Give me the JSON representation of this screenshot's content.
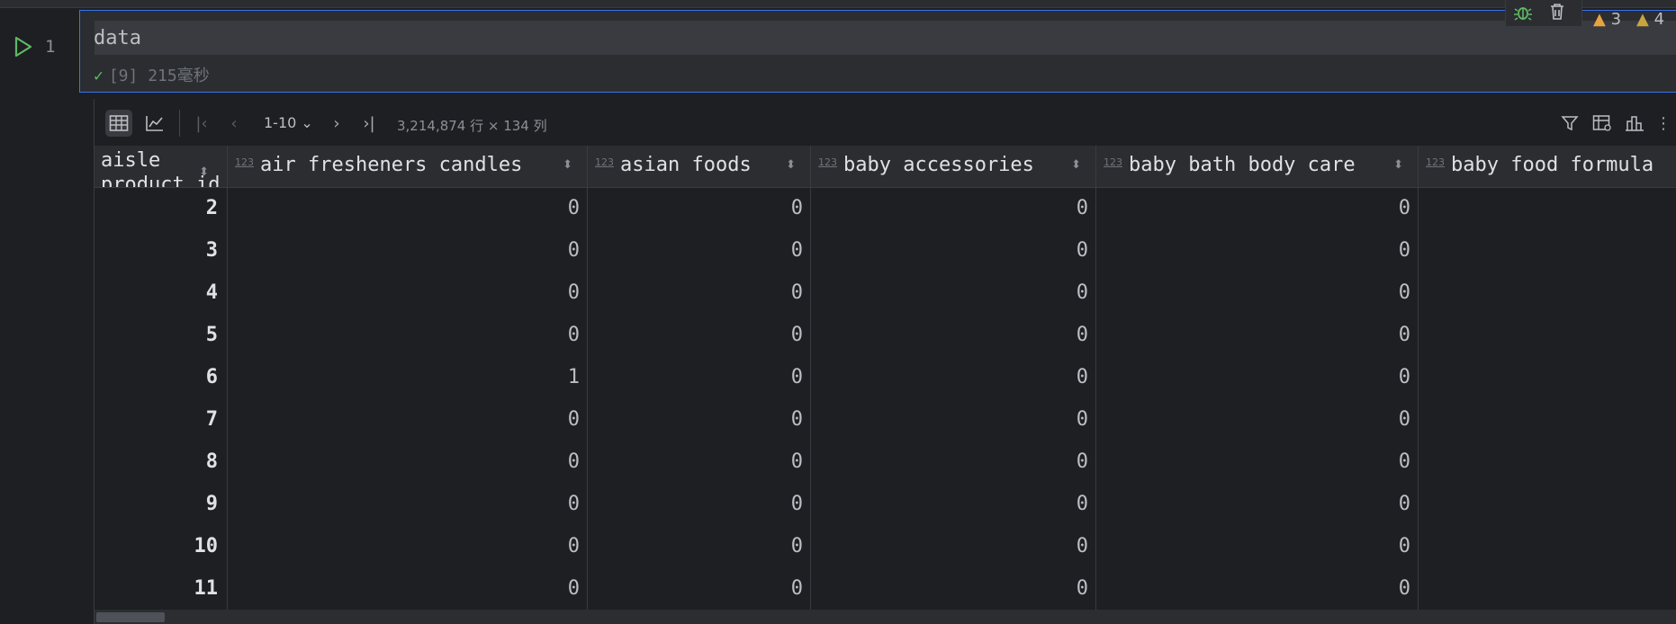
{
  "cell": {
    "line_number": "1",
    "code": "data",
    "status_text": "[9] 215毫秒",
    "warnings": [
      {
        "count": "3"
      },
      {
        "count": "4"
      }
    ]
  },
  "grid": {
    "pager_label": "1-10",
    "row_info": "3,214,874 行 × 134 列",
    "index_header_line1": "aisle",
    "index_header_line2": "product_id",
    "columns": [
      {
        "type": "123",
        "name": "air fresheners candles"
      },
      {
        "type": "123",
        "name": "asian foods"
      },
      {
        "type": "123",
        "name": "baby accessories"
      },
      {
        "type": "123",
        "name": "baby bath body care"
      },
      {
        "type": "123",
        "name": "baby food formula"
      }
    ],
    "rows": [
      {
        "index": "2",
        "values": [
          "0",
          "0",
          "0",
          "0",
          ""
        ]
      },
      {
        "index": "3",
        "values": [
          "0",
          "0",
          "0",
          "0",
          ""
        ]
      },
      {
        "index": "4",
        "values": [
          "0",
          "0",
          "0",
          "0",
          ""
        ]
      },
      {
        "index": "5",
        "values": [
          "0",
          "0",
          "0",
          "0",
          ""
        ]
      },
      {
        "index": "6",
        "values": [
          "1",
          "0",
          "0",
          "0",
          ""
        ]
      },
      {
        "index": "7",
        "values": [
          "0",
          "0",
          "0",
          "0",
          ""
        ]
      },
      {
        "index": "8",
        "values": [
          "0",
          "0",
          "0",
          "0",
          ""
        ]
      },
      {
        "index": "9",
        "values": [
          "0",
          "0",
          "0",
          "0",
          ""
        ]
      },
      {
        "index": "10",
        "values": [
          "0",
          "0",
          "0",
          "0",
          ""
        ]
      },
      {
        "index": "11",
        "values": [
          "0",
          "0",
          "0",
          "0",
          ""
        ]
      }
    ]
  },
  "colors": {
    "accent": "#3574f0",
    "success": "#5fb865",
    "warning": "#e8a33d"
  }
}
